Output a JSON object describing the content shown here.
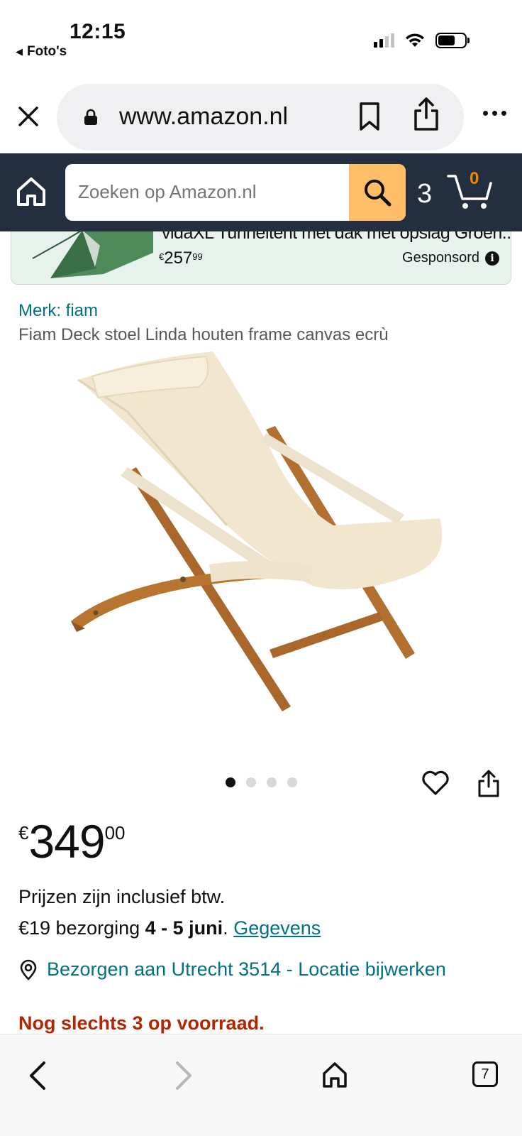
{
  "status_bar": {
    "time": "12:15",
    "back_app": "Foto's"
  },
  "browser": {
    "url": "www.amazon.nl",
    "tabs_count": "7"
  },
  "amazon_header": {
    "search_placeholder": "Zoeken op Amazon.nl",
    "account_glyph": "3",
    "cart_count": "0"
  },
  "sponsored": {
    "title": "vidaXL Tunneltent met dak met opslag Groen...",
    "price_currency": "€",
    "price_whole": "257",
    "price_fraction": "99",
    "label": "Gesponsord",
    "info_glyph": "i"
  },
  "product": {
    "brand": "Merk: fiam",
    "title": "Fiam Deck stoel Linda houten frame canvas ecrù",
    "image_count": 4,
    "active_image": 1,
    "price_currency": "€",
    "price_whole": "349",
    "price_fraction": "00",
    "vat_text": "Prijzen zijn inclusief btw.",
    "delivery_prefix": "€19 bezorging ",
    "delivery_date": "4 - 5 juni",
    "delivery_sep": ". ",
    "delivery_link": "Gegevens",
    "location": "Bezorgen aan Utrecht 3514 - Locatie bijwerken",
    "stock": "Nog slechts 3 op voorraad."
  },
  "colors": {
    "amazon_navy": "#232f3e",
    "search_button": "#febd69",
    "link": "#007185",
    "stock_red": "#b12704",
    "cart_orange": "#f08804"
  }
}
